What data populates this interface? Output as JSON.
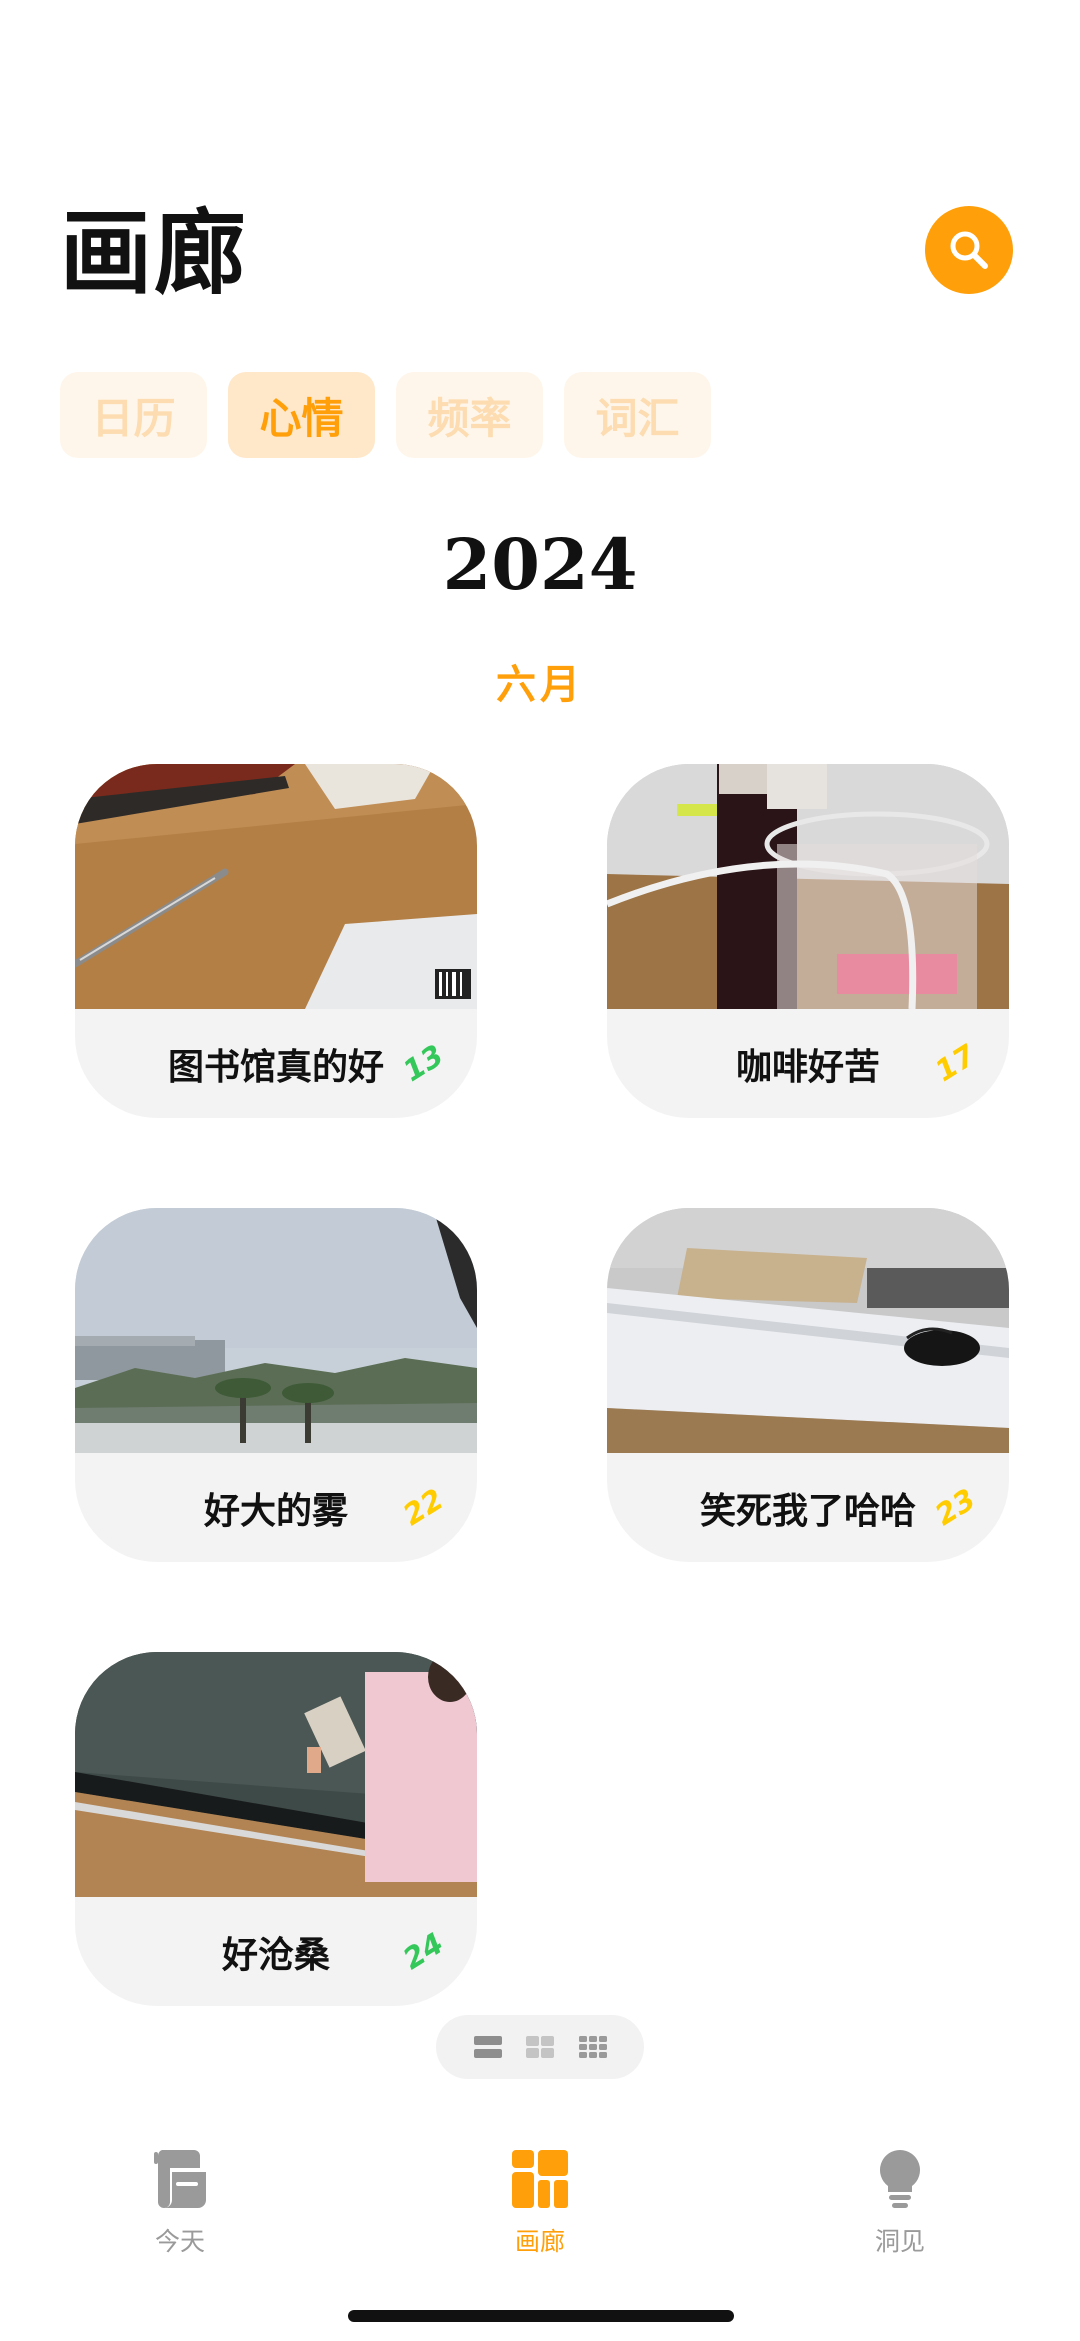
{
  "header": {
    "title": "画廊",
    "search_icon": "search-icon"
  },
  "segments": [
    {
      "label": "日历",
      "selected": false
    },
    {
      "label": "心情",
      "selected": true
    },
    {
      "label": "频率",
      "selected": false
    },
    {
      "label": "词汇",
      "selected": false
    }
  ],
  "year": "2024",
  "month": "六月",
  "cards": [
    {
      "title": "图书馆真的好",
      "day": "13",
      "mood_color": "#34c759"
    },
    {
      "title": "咖啡好苦",
      "day": "17",
      "mood_color": "#ffcc00"
    },
    {
      "title": "好大的雾",
      "day": "22",
      "mood_color": "#ffcc00"
    },
    {
      "title": "笑死我了哈哈",
      "day": "23",
      "mood_color": "#ffcc00"
    },
    {
      "title": "好沧桑",
      "day": "24",
      "mood_color": "#34c759"
    }
  ],
  "layout_switch": [
    "rows-icon",
    "grid-2-icon",
    "grid-3-icon"
  ],
  "tabbar": [
    {
      "label": "今天",
      "icon": "journal-icon",
      "active": false
    },
    {
      "label": "画廊",
      "icon": "gallery-icon",
      "active": true
    },
    {
      "label": "洞见",
      "icon": "lightbulb-icon",
      "active": false
    }
  ],
  "colors": {
    "accent": "#ff9f0a",
    "inactive": "#9a9a9a",
    "mood_green": "#34c759",
    "mood_yellow": "#ffcc00"
  }
}
